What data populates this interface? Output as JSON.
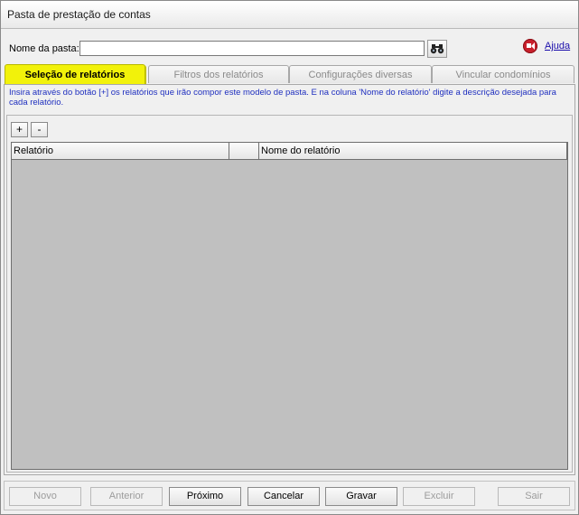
{
  "window": {
    "title": "Pasta de prestação de contas"
  },
  "name_row": {
    "label": "Nome da pasta:",
    "value": "",
    "search_icon": "binoculars-icon",
    "help_icon": "help-video-icon",
    "help_label": "Ajuda"
  },
  "tabs": [
    {
      "label": "Seleção de relatórios",
      "active": true
    },
    {
      "label": "Filtros dos relatórios",
      "active": false
    },
    {
      "label": "Configurações diversas",
      "active": false
    },
    {
      "label": "Vincular condomínios",
      "active": false
    }
  ],
  "panel": {
    "hint": "Insira através do botão [+] os relatórios que irão compor este modelo de pasta. E na coluna 'Nome do relatório' digite a descrição desejada para cada relatório.",
    "add_label": "+",
    "remove_label": "-",
    "columns": [
      "Relatório",
      "",
      "Nome do relatório"
    ]
  },
  "footer": {
    "buttons": [
      {
        "label": "Novo",
        "enabled": false
      },
      {
        "label": "Anterior",
        "enabled": false
      },
      {
        "label": "Próximo",
        "enabled": true
      },
      {
        "label": "Cancelar",
        "enabled": true
      },
      {
        "label": "Gravar",
        "enabled": true
      },
      {
        "label": "Excluir",
        "enabled": false
      },
      {
        "label": "Sair",
        "enabled": false
      }
    ]
  },
  "colors": {
    "active_tab": "#f2f20a",
    "hint_text": "#1f2fbf",
    "grid_bg": "#c0c0c0"
  }
}
